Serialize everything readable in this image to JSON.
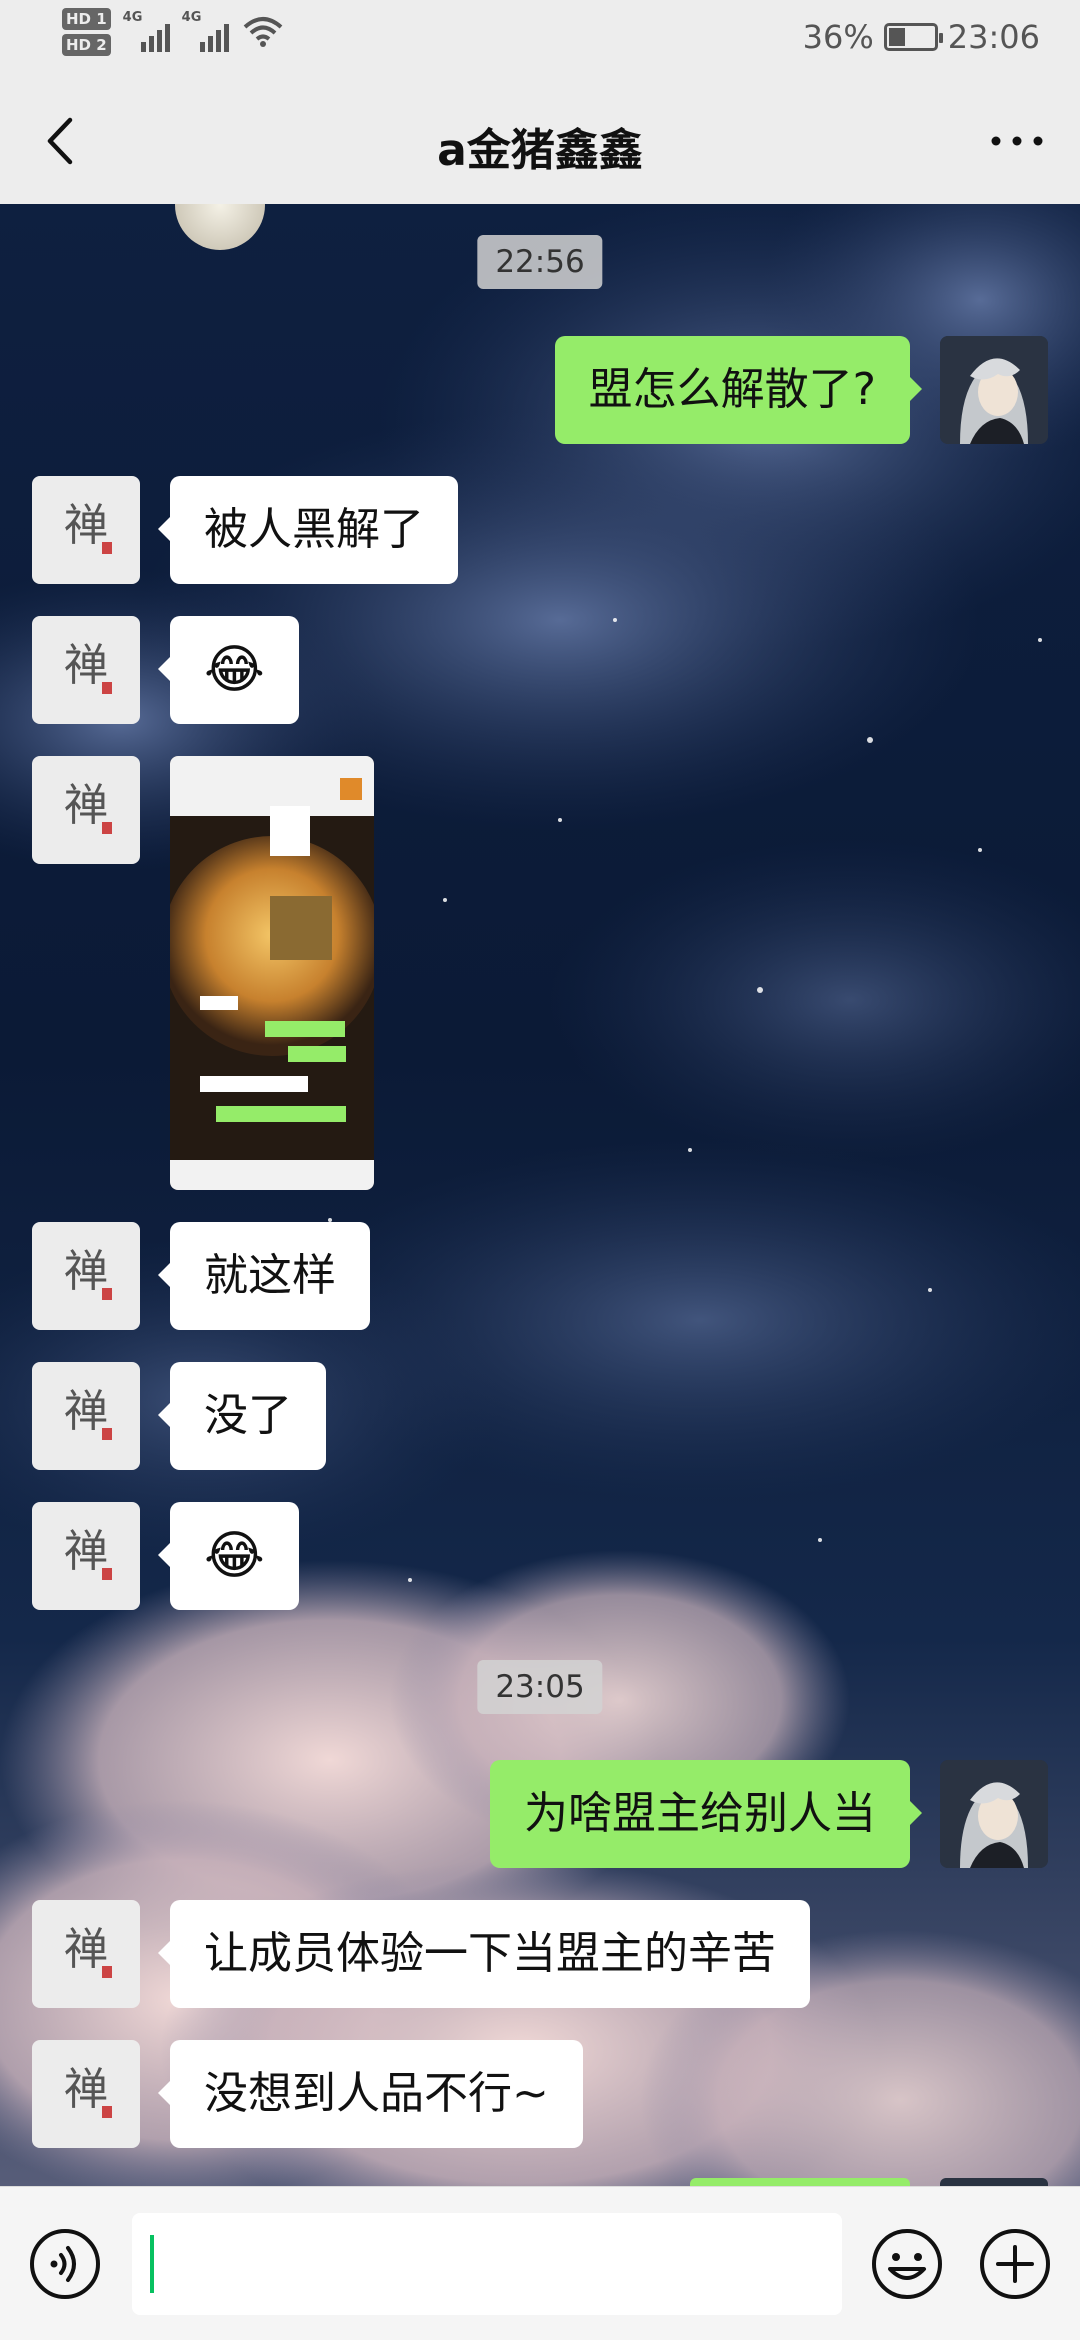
{
  "status_bar": {
    "sim_labels": [
      "HD 1",
      "HD 2"
    ],
    "network_labels": [
      "4G",
      "4G"
    ],
    "battery_percent_text": "36%",
    "battery_level": 0.36,
    "time": "23:06"
  },
  "header": {
    "title": "a金猪鑫鑫",
    "back_icon": "chevron-left-icon",
    "more_icon": "more-dots-icon"
  },
  "contact_avatar_char": "禅",
  "messages": [
    {
      "type": "time",
      "text": "22:56"
    },
    {
      "type": "text",
      "from": "me",
      "text": "盟怎么解散了?"
    },
    {
      "type": "text",
      "from": "other",
      "text": "被人黑解了"
    },
    {
      "type": "emoji",
      "from": "other",
      "text": "😂"
    },
    {
      "type": "image",
      "from": "other",
      "image_label": "chat screenshot"
    },
    {
      "type": "text",
      "from": "other",
      "text": "就这样"
    },
    {
      "type": "text",
      "from": "other",
      "text": "没了"
    },
    {
      "type": "emoji",
      "from": "other",
      "text": "😂"
    },
    {
      "type": "time",
      "text": "23:05"
    },
    {
      "type": "text",
      "from": "me",
      "text": "为啥盟主给别人当"
    },
    {
      "type": "text",
      "from": "other",
      "text": "让成员体验一下当盟主的辛苦"
    },
    {
      "type": "text",
      "from": "other",
      "text": "没想到人品不行~"
    }
  ],
  "input_bar": {
    "voice_icon": "voice-icon",
    "emoji_icon": "emoji-icon",
    "add_icon": "add-icon",
    "input_value": ""
  },
  "colors": {
    "outgoing_bubble": "#95ec69",
    "incoming_bubble": "#ffffff",
    "cursor": "#07c160",
    "bar_background": "#ededed"
  }
}
